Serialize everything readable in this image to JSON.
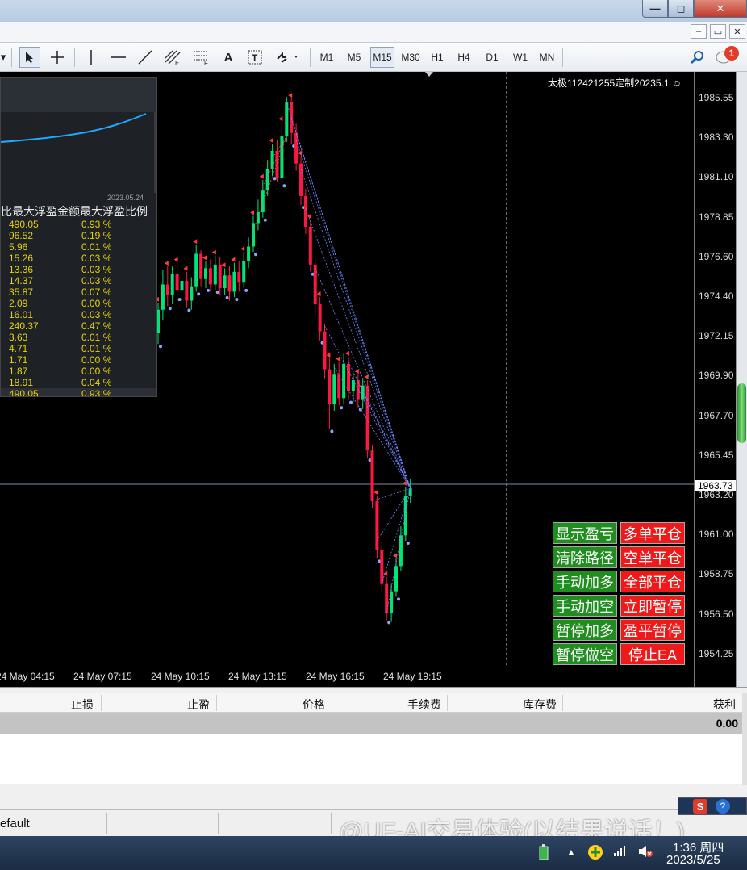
{
  "window": {
    "min": "—",
    "max": "◻",
    "close": "✕"
  },
  "mdi": {
    "min": "–",
    "restore": "▭",
    "close": "✕"
  },
  "toolbar": {
    "timeframes": [
      "M1",
      "M5",
      "M15",
      "M30",
      "H1",
      "H4",
      "D1",
      "W1",
      "MN"
    ],
    "active_timeframe": "M15",
    "notification_count": "1"
  },
  "chart": {
    "ea_title": "太极112421255定制20235.1 ☺",
    "current_price": "1963.73",
    "price_labels": [
      "1985.55",
      "1983.30",
      "1981.10",
      "1978.85",
      "1976.60",
      "1974.40",
      "1972.15",
      "1969.90",
      "1967.70",
      "1965.45",
      "1963.20",
      "1961.00",
      "1958.75",
      "1956.50",
      "1954.25"
    ],
    "time_labels": [
      "24 May 04:15",
      "24 May 07:15",
      "24 May 10:15",
      "24 May 13:15",
      "24 May 16:15",
      "24 May 19:15"
    ]
  },
  "panel": {
    "date": "2023.05.24",
    "header": "比最大浮盈金额最大浮盈比例",
    "rows": [
      [
        "490.05",
        "0.93 %"
      ],
      [
        "96.52",
        "0.19 %"
      ],
      [
        "5.96",
        "0.01 %"
      ],
      [
        "15.26",
        "0.03 %"
      ],
      [
        "13.36",
        "0.03 %"
      ],
      [
        "14.37",
        "0.03 %"
      ],
      [
        "35.87",
        "0.07 %"
      ],
      [
        "2.09",
        "0.00 %"
      ],
      [
        "16.01",
        "0.03 %"
      ],
      [
        "240.37",
        "0.47 %"
      ],
      [
        "3.63",
        "0.01 %"
      ],
      [
        "4.71",
        "0.01 %"
      ],
      [
        "1.71",
        "0.00 %"
      ],
      [
        "1.87",
        "0.00 %"
      ],
      [
        "18.91",
        "0.04 %"
      ]
    ],
    "total": [
      "490.05",
      "0.93 %"
    ]
  },
  "buttons": {
    "left": [
      "显示盈亏",
      "清除路径",
      "手动加多",
      "手动加空",
      "暂停加多",
      "暂停做空"
    ],
    "right": [
      "多单平仓",
      "空单平仓",
      "全部平仓",
      "立即暂停",
      "盈平暂停",
      "停止EA"
    ]
  },
  "terminal": {
    "columns": [
      "止损",
      "止盈",
      "价格",
      "手续费",
      "库存费",
      "获利"
    ],
    "profit_total": "0.00"
  },
  "status": {
    "profile": "efault"
  },
  "watermark": "@UF-AI交易体验(以结果说话！)",
  "taskbar": {
    "time": "1:36 周四",
    "date": "2023/5/25"
  },
  "colors": {
    "bull": "#00e676",
    "bear": "#ff1744",
    "buy_btn": "#1f8e1f",
    "sell_btn": "#ee1a1a"
  }
}
